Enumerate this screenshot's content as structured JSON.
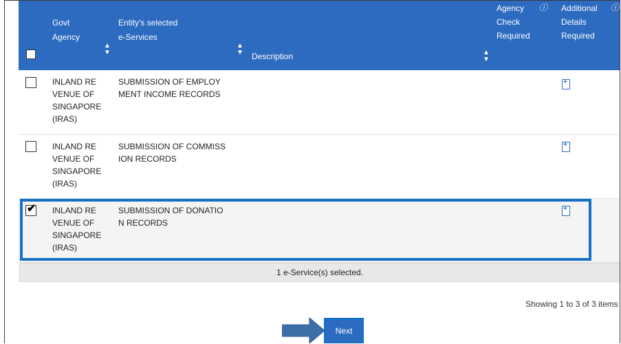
{
  "table": {
    "headers": {
      "govt_agency": "Govt\nAgency",
      "eservices": "Entity's selected\ne-Services",
      "description": "Description",
      "agency_check": "Agency\nCheck\nRequired",
      "additional_details": "Additional\nDetails\nRequired"
    },
    "rows": [
      {
        "agency": "INLAND RE\nVENUE OF\nSINGAPORE\n(IRAS)",
        "service": "SUBMISSION OF EMPLOY\nMENT INCOME RECORDS",
        "description": "",
        "checked": false
      },
      {
        "agency": "INLAND RE\nVENUE OF\nSINGAPORE\n(IRAS)",
        "service": "SUBMISSION OF COMMISS\nION RECORDS",
        "description": "",
        "checked": false
      },
      {
        "agency": "INLAND RE\nVENUE OF\nSINGAPORE\n(IRAS)",
        "service": "SUBMISSION OF DONATIO\nN RECORDS",
        "description": "",
        "checked": true
      }
    ],
    "summary": "1 e-Service(s) selected.",
    "showing": "Showing 1 to 3 of 3 items"
  },
  "actions": {
    "next_label": "Next"
  },
  "icons": {
    "sort": "sort-icon",
    "info": "info-icon",
    "details": "document-plus-icon",
    "arrow": "arrow-right-icon"
  },
  "colors": {
    "header_bg": "#2d6bc0",
    "highlight": "#1770c7",
    "summary_bg": "#e8e8e8"
  }
}
